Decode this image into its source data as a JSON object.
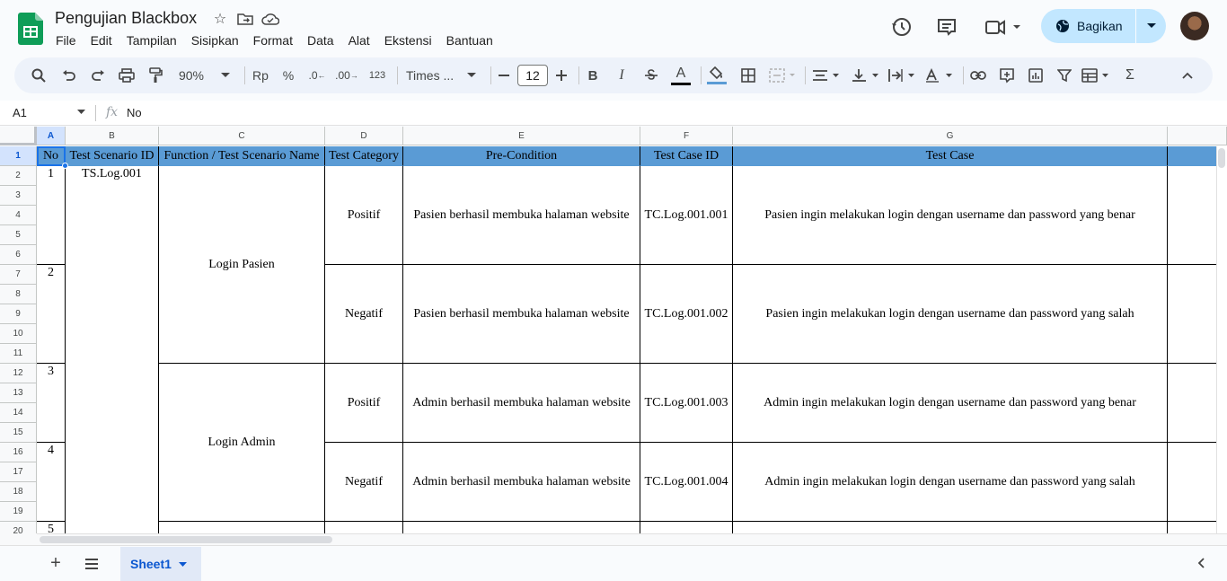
{
  "app": {
    "doc_title": "Pengujian Blackbox",
    "menu": [
      "File",
      "Edit",
      "Tampilan",
      "Sisipkan",
      "Format",
      "Data",
      "Alat",
      "Ekstensi",
      "Bantuan"
    ],
    "share_label": "Bagikan",
    "brand_color": "#0f9d58",
    "share_color": "#c2e7ff"
  },
  "toolbar": {
    "zoom": "90%",
    "currency": "Rp",
    "percent": "%",
    "dec_decrease": ".0",
    "dec_increase": ".00",
    "number_format": "123",
    "font": "Times ...",
    "font_size": "12",
    "bold": "B",
    "italic": "I",
    "text_color_letter": "A",
    "sum": "Σ"
  },
  "formula_bar": {
    "cell_ref": "A1",
    "fx": "fx",
    "value": "No"
  },
  "columns": [
    "A",
    "B",
    "C",
    "D",
    "E",
    "F",
    "G"
  ],
  "rows": [
    "1",
    "2",
    "3",
    "4",
    "5",
    "6",
    "7",
    "8",
    "9",
    "10",
    "11",
    "12",
    "13",
    "14",
    "15",
    "16",
    "17",
    "18",
    "19",
    "20"
  ],
  "header": {
    "no": "No",
    "scenario_id": "Test Scenario ID",
    "function": "Function / Test Scenario Name",
    "category": "Test Category",
    "precondition": "Pre-Condition",
    "case_id": "Test Case ID",
    "test_case": "Test Case",
    "header_color": "#5a9bd5"
  },
  "body": {
    "scenario_id": "TS.Log.001",
    "groups": [
      {
        "function": "Login Pasien"
      },
      {
        "function": "Login Admin"
      }
    ],
    "cases": [
      {
        "no": "1",
        "category": "Positif",
        "precondition": "Pasien berhasil membuka halaman website",
        "case_id": "TC.Log.001.001",
        "test_case": "Pasien ingin melakukan login dengan username dan password yang benar"
      },
      {
        "no": "2",
        "category": "Negatif",
        "precondition": "Pasien berhasil membuka halaman website",
        "case_id": "TC.Log.001.002",
        "test_case": "Pasien ingin melakukan login dengan username dan password yang salah"
      },
      {
        "no": "3",
        "category": "Positif",
        "precondition": "Admin berhasil membuka halaman website",
        "case_id": "TC.Log.001.003",
        "test_case": "Admin ingin melakukan login dengan username dan password yang benar"
      },
      {
        "no": "4",
        "category": "Negatif",
        "precondition": "Admin berhasil membuka halaman website",
        "case_id": "TC.Log.001.004",
        "test_case": "Admin ingin melakukan login dengan username dan password yang salah"
      }
    ],
    "next_no": "5"
  },
  "sheets": [
    {
      "name": "Sheet1",
      "active": true
    }
  ]
}
